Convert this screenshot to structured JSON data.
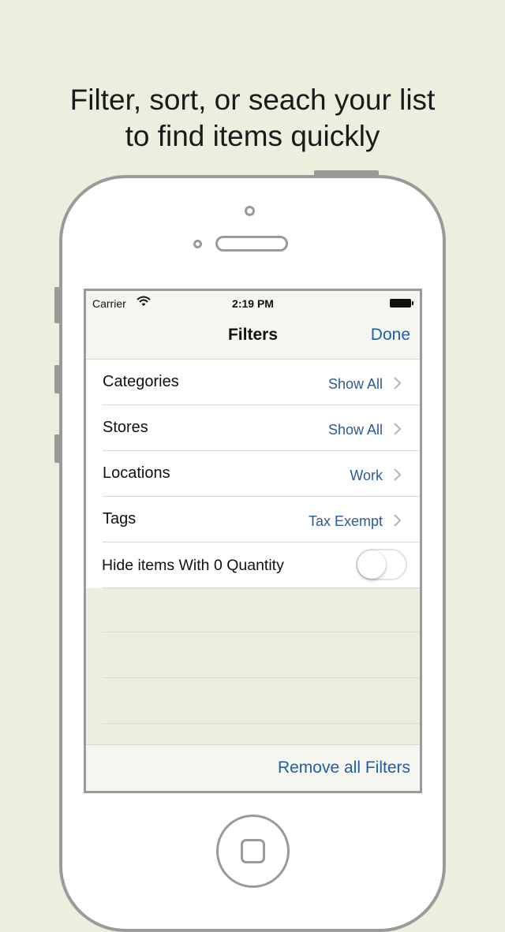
{
  "headline": {
    "line1": "Filter, sort, or seach your list",
    "line2": "to find items quickly"
  },
  "status_bar": {
    "carrier": "Carrier",
    "time": "2:19 PM"
  },
  "nav": {
    "title": "Filters",
    "done_label": "Done"
  },
  "filters": [
    {
      "label": "Categories",
      "value": "Show All"
    },
    {
      "label": "Stores",
      "value": "Show All"
    },
    {
      "label": "Locations",
      "value": "Work"
    },
    {
      "label": "Tags",
      "value": "Tax Exempt"
    }
  ],
  "hide_zero": {
    "label": "Hide items With 0 Quantity",
    "on": false
  },
  "toolbar": {
    "remove_label": "Remove all Filters"
  },
  "colors": {
    "background": "#eeeedf",
    "accent": "#1f5fa8",
    "value_text": "#2a5b93",
    "frame": "#9a9a9a"
  }
}
